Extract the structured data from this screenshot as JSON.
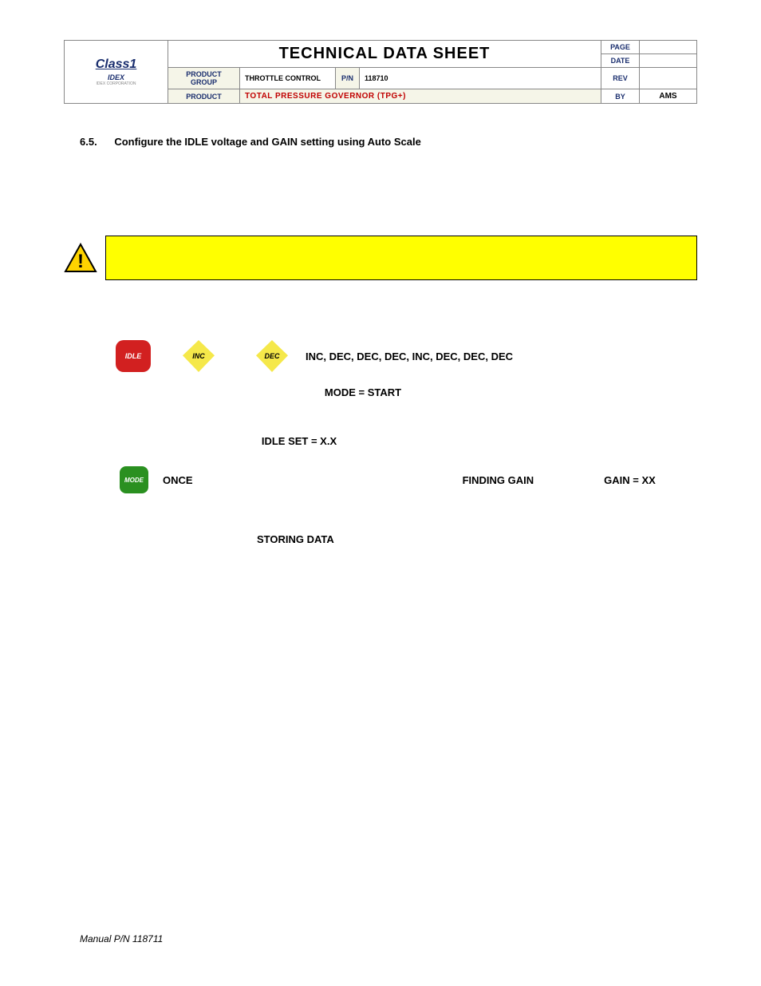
{
  "header": {
    "logo_top": "Class1",
    "logo_bot": "IDEX",
    "logo_sub": "IDEX CORPORATION",
    "title": "TECHNICAL DATA SHEET",
    "labels": {
      "page": "PAGE",
      "date": "DATE",
      "product_group": "PRODUCT GROUP",
      "pn": "P/N",
      "product": "PRODUCT",
      "rev": "REV",
      "by": "BY"
    },
    "values": {
      "page": "",
      "date": "",
      "throttle": "THROTTLE CONTROL",
      "pn": "118710",
      "product_full": "TOTAL PRESSURE GOVERNOR        (TPG+)",
      "rev": "",
      "by": "AMS"
    }
  },
  "section": {
    "number": "6.5.",
    "title": "Configure the IDLE voltage and GAIN setting using Auto Scale"
  },
  "buttons": {
    "idle": "IDLE",
    "inc": "INC",
    "dec": "DEC",
    "mode": "MODE"
  },
  "sequence": "INC, DEC, DEC, DEC, INC, DEC, DEC, DEC",
  "mode_line": "MODE = START",
  "idle_set": "IDLE SET = X.X",
  "once": "ONCE",
  "finding": "FINDING GAIN",
  "gain": "GAIN = XX",
  "storing": "STORING DATA",
  "footer": "Manual P/N 118711"
}
